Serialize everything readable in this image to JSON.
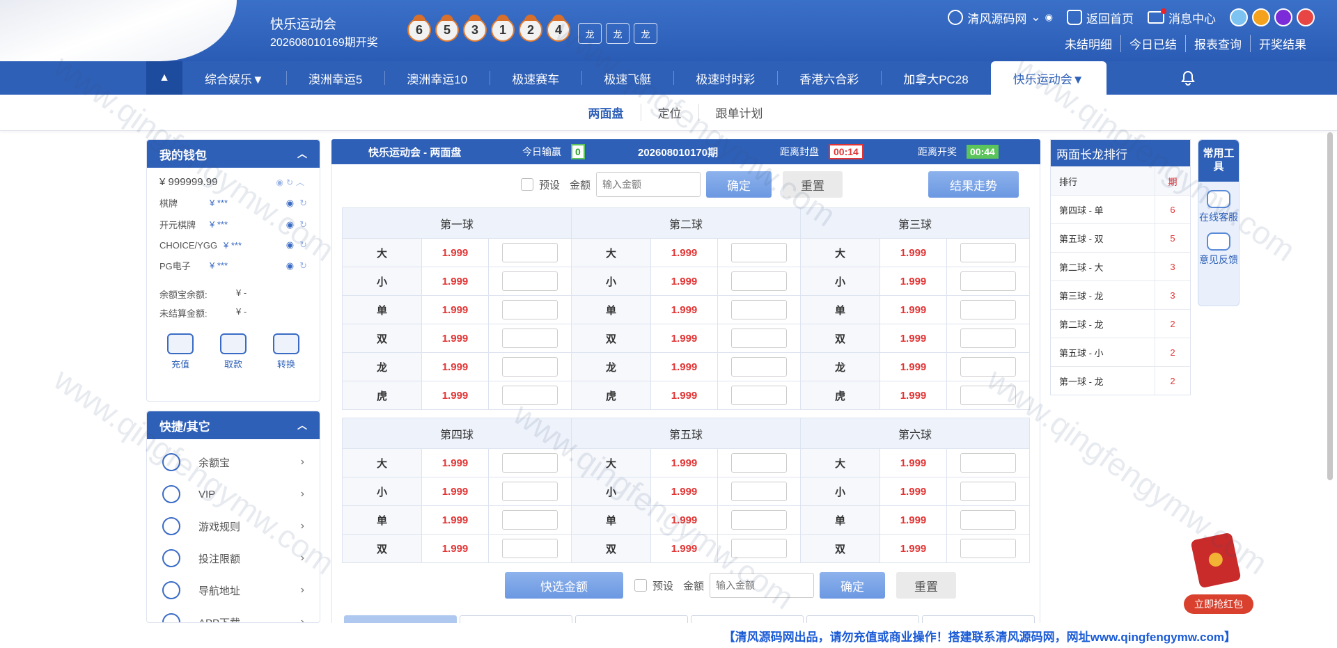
{
  "header": {
    "game_name": "快乐运动会",
    "issue_line": "202608010169期开奖",
    "balls": [
      "6",
      "5",
      "3",
      "1",
      "2",
      "4"
    ],
    "dragons": [
      "龙",
      "龙",
      "龙"
    ],
    "user": "清风源码网",
    "home": "返回首页",
    "messages": "消息中心",
    "theme_colors": [
      "#7cc3f2",
      "#f4a21d",
      "#7b2bd8",
      "#e84545"
    ],
    "sub_links": [
      "未结明细",
      "今日已结",
      "报表查询",
      "开奖结果"
    ]
  },
  "nav": {
    "toggle": "▲",
    "items": [
      "综合娱乐▼",
      "澳洲幸运5",
      "澳洲幸运10",
      "极速赛车",
      "极速飞艇",
      "极速时时彩",
      "香港六合彩",
      "加拿大PC28",
      "快乐运动会▼"
    ],
    "bell": "🔔"
  },
  "subtabs": [
    "两面盘",
    "定位",
    "跟单计划"
  ],
  "wallet": {
    "title": "我的钱包",
    "balance": "¥ 999999.99",
    "rows": [
      {
        "label": "棋牌",
        "value": "¥ ***"
      },
      {
        "label": "开元棋牌",
        "value": "¥ ***"
      },
      {
        "label": "CHOICE/YGG",
        "value": "¥ ***"
      },
      {
        "label": "PG电子",
        "value": "¥ ***"
      }
    ],
    "stats": [
      {
        "label": "余额宝余额:",
        "value": "¥ -"
      },
      {
        "label": "未结算金额:",
        "value": "¥ -"
      }
    ],
    "actions": [
      "充值",
      "取款",
      "转换"
    ]
  },
  "quick": {
    "title": "快捷/其它",
    "items": [
      "余额宝",
      "VIP",
      "游戏规则",
      "投注限额",
      "导航地址",
      "APP下载"
    ]
  },
  "board": {
    "title": "快乐运动会 - 两面盘",
    "today_label": "今日输赢",
    "today_value": "0",
    "issue": "202608010170期",
    "close_label": "距离封盘",
    "close_value": "00:14",
    "draw_label": "距离开奖",
    "draw_value": "00:44",
    "preset": "预设",
    "amount_label": "金额",
    "amount_placeholder": "输入金额",
    "confirm": "确定",
    "reset": "重置",
    "trend": "结果走势",
    "quick_amount": "快选金额",
    "group1_headers": [
      "第一球",
      "第二球",
      "第三球"
    ],
    "group1_rows": [
      "大",
      "小",
      "单",
      "双",
      "龙",
      "虎"
    ],
    "group2_headers": [
      "第四球",
      "第五球",
      "第六球"
    ],
    "group2_rows": [
      "大",
      "小",
      "单",
      "双"
    ],
    "odds": "1.999"
  },
  "ranking": {
    "title": "两面长龙排行",
    "col1": "排行",
    "col2": "期",
    "rows": [
      {
        "name": "第四球 - 单",
        "count": "6"
      },
      {
        "name": "第五球 - 双",
        "count": "5"
      },
      {
        "name": "第二球 - 大",
        "count": "3"
      },
      {
        "name": "第三球 - 龙",
        "count": "3"
      },
      {
        "name": "第二球 - 龙",
        "count": "2"
      },
      {
        "name": "第五球 - 小",
        "count": "2"
      },
      {
        "name": "第一球 - 龙",
        "count": "2"
      }
    ]
  },
  "tools": {
    "title": "常用工具",
    "service": "在线客服",
    "feedback": "意见反馈"
  },
  "redpack": "立即抢红包",
  "footer": "【清风源码网出品，请勿充值或商业操作！搭建联系清风源码网，网址www.qingfengymw.com】",
  "watermark": "www.qingfengymw.com"
}
